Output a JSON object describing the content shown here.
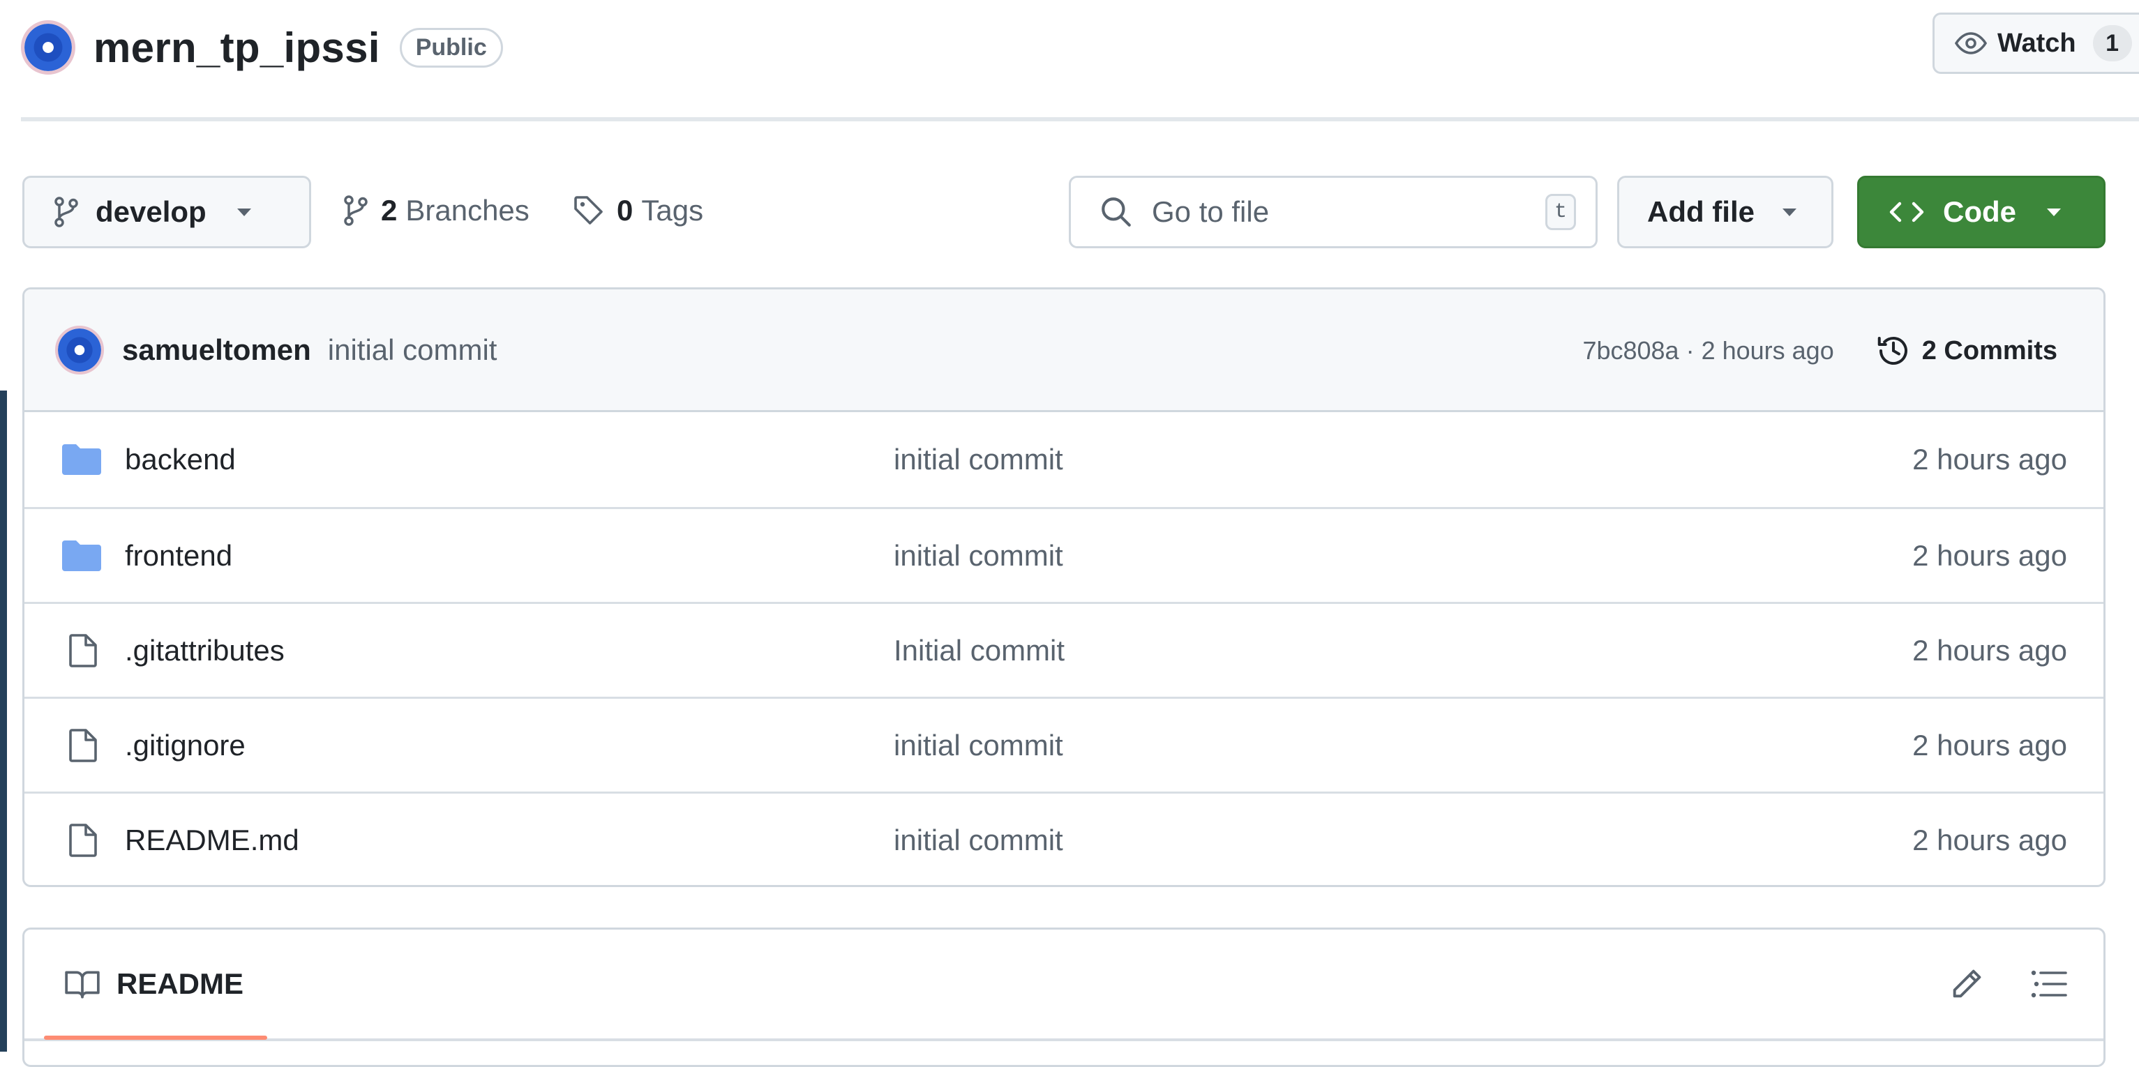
{
  "repo": {
    "name": "mern_tp_ipssi",
    "visibility": "Public",
    "watch_label": "Watch",
    "watch_count": "1"
  },
  "toolbar": {
    "branch": "develop",
    "branches_count": "2",
    "branches_label": "Branches",
    "tags_count": "0",
    "tags_label": "Tags",
    "search_placeholder": "Go to file",
    "search_shortcut": "t",
    "add_file_label": "Add file",
    "code_label": "Code"
  },
  "latest_commit": {
    "author": "samueltomen",
    "message": "initial commit",
    "sha_time": "7bc808a · 2 hours ago",
    "commits_label": "2 Commits"
  },
  "files": [
    {
      "name": "backend",
      "type": "folder",
      "icon": "folder-icon",
      "message": "initial commit",
      "date": "2 hours ago"
    },
    {
      "name": "frontend",
      "type": "folder",
      "icon": "folder-icon",
      "message": "initial commit",
      "date": "2 hours ago"
    },
    {
      "name": ".gitattributes",
      "type": "file",
      "icon": "file-icon",
      "message": "Initial commit",
      "date": "2 hours ago"
    },
    {
      "name": ".gitignore",
      "type": "file",
      "icon": "file-icon",
      "message": "initial commit",
      "date": "2 hours ago"
    },
    {
      "name": "README.md",
      "type": "file",
      "icon": "file-icon",
      "message": "initial commit",
      "date": "2 hours ago"
    }
  ],
  "readme": {
    "tab_label": "README"
  },
  "colors": {
    "code_button": "#3c873a",
    "folder": "#79a8f2",
    "readme_underline": "#fd8c73",
    "left_edge": "#24405a"
  }
}
